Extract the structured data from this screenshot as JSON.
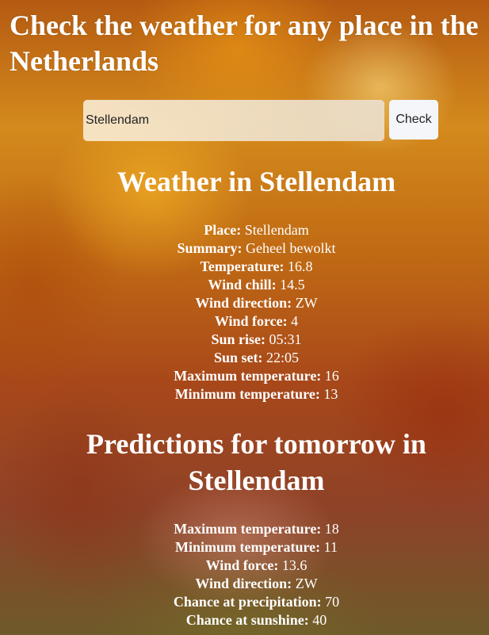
{
  "page": {
    "title": "Check the weather for any place in the Netherlands"
  },
  "search": {
    "value": "Stellendam",
    "button_label": "Check"
  },
  "current": {
    "heading": "Weather in Stellendam",
    "rows": [
      {
        "label": "Place:",
        "value": "Stellendam"
      },
      {
        "label": "Summary:",
        "value": "Geheel bewolkt"
      },
      {
        "label": "Temperature:",
        "value": "16.8"
      },
      {
        "label": "Wind chill:",
        "value": "14.5"
      },
      {
        "label": "Wind direction:",
        "value": "ZW"
      },
      {
        "label": "Wind force:",
        "value": "4"
      },
      {
        "label": "Sun rise:",
        "value": "05:31"
      },
      {
        "label": "Sun set:",
        "value": "22:05"
      },
      {
        "label": "Maximum temperature:",
        "value": "16"
      },
      {
        "label": "Minimum temperature:",
        "value": "13"
      }
    ]
  },
  "tomorrow": {
    "heading_line1": "Predictions for tomorrow in",
    "heading_line2": "Stellendam",
    "rows": [
      {
        "label": "Maximum temperature:",
        "value": "18"
      },
      {
        "label": "Minimum temperature:",
        "value": "11"
      },
      {
        "label": "Wind force:",
        "value": "13.6"
      },
      {
        "label": "Wind direction:",
        "value": "ZW"
      },
      {
        "label": "Chance at precipitation:",
        "value": "70"
      },
      {
        "label": "Chance at sunshine:",
        "value": "40"
      }
    ]
  }
}
